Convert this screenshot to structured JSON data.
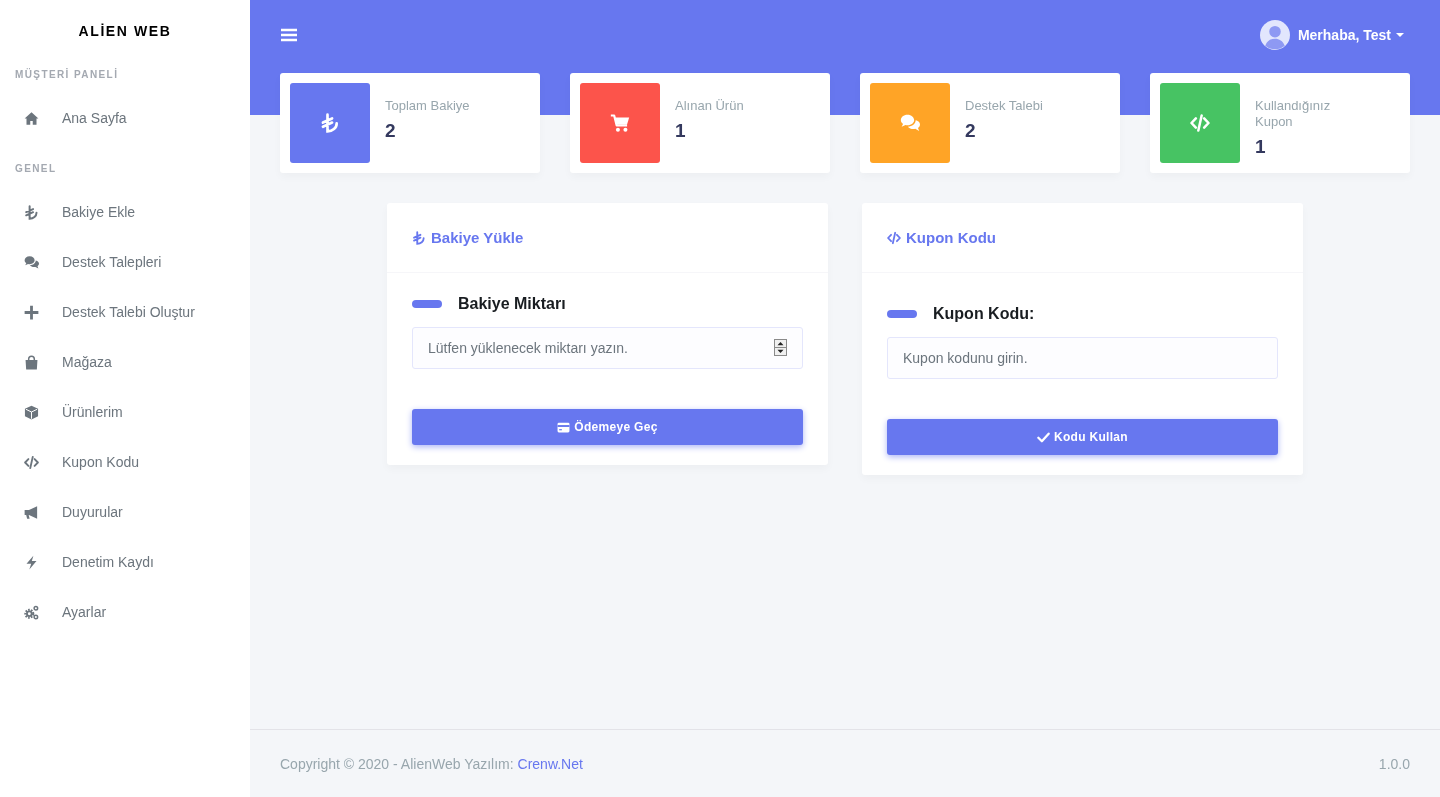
{
  "sidebar": {
    "brand": "ALİEN WEB",
    "sections": [
      {
        "title": "MÜŞTERİ PANELİ",
        "items": [
          {
            "label": "Ana Sayfa",
            "selected": false
          }
        ]
      },
      {
        "title": "GENEL",
        "items": [
          {
            "label": "Bakiye Ekle",
            "selected": false
          },
          {
            "label": "Destek Talepleri",
            "selected": false
          },
          {
            "label": "Destek Talebi Oluştur",
            "selected": false
          },
          {
            "label": "Mağaza",
            "selected": false
          },
          {
            "label": "Ürünlerim",
            "selected": false
          },
          {
            "label": "Kupon Kodu",
            "selected": false
          },
          {
            "label": "Duyurular",
            "selected": false
          },
          {
            "label": "Denetim Kaydı",
            "selected": false
          },
          {
            "label": "Ayarlar",
            "selected": false
          }
        ]
      }
    ]
  },
  "header": {
    "greeting": "Merhaba, Test"
  },
  "stats": [
    {
      "label": "Toplam Bakiye",
      "value": "2",
      "color": "#6777ef"
    },
    {
      "label": "Alınan Ürün",
      "value": "1",
      "color": "#fc544b"
    },
    {
      "label": "Destek Talebi",
      "value": "2",
      "color": "#ffa426"
    },
    {
      "label": "Kullandığınız Kupon",
      "value": "1",
      "color": "#47c363"
    }
  ],
  "panels": [
    {
      "title": "Bakiye Yükle",
      "field_label": "Bakiye Miktarı",
      "field": {
        "kind": "number",
        "placeholder": "Lütfen yüklenecek miktarı yazın."
      },
      "button": "Ödemeye Geç"
    },
    {
      "title": "Kupon Kodu",
      "field_label": "Kupon Kodu:",
      "field": {
        "kind": "text",
        "placeholder": "Kupon kodunu girin."
      },
      "button": "Kodu Kullan"
    }
  ],
  "footer": {
    "copyright": "Copyright © 2020 - AlienWeb Yazılım:",
    "link": "Crenw.Net",
    "version": "1.0.0"
  }
}
